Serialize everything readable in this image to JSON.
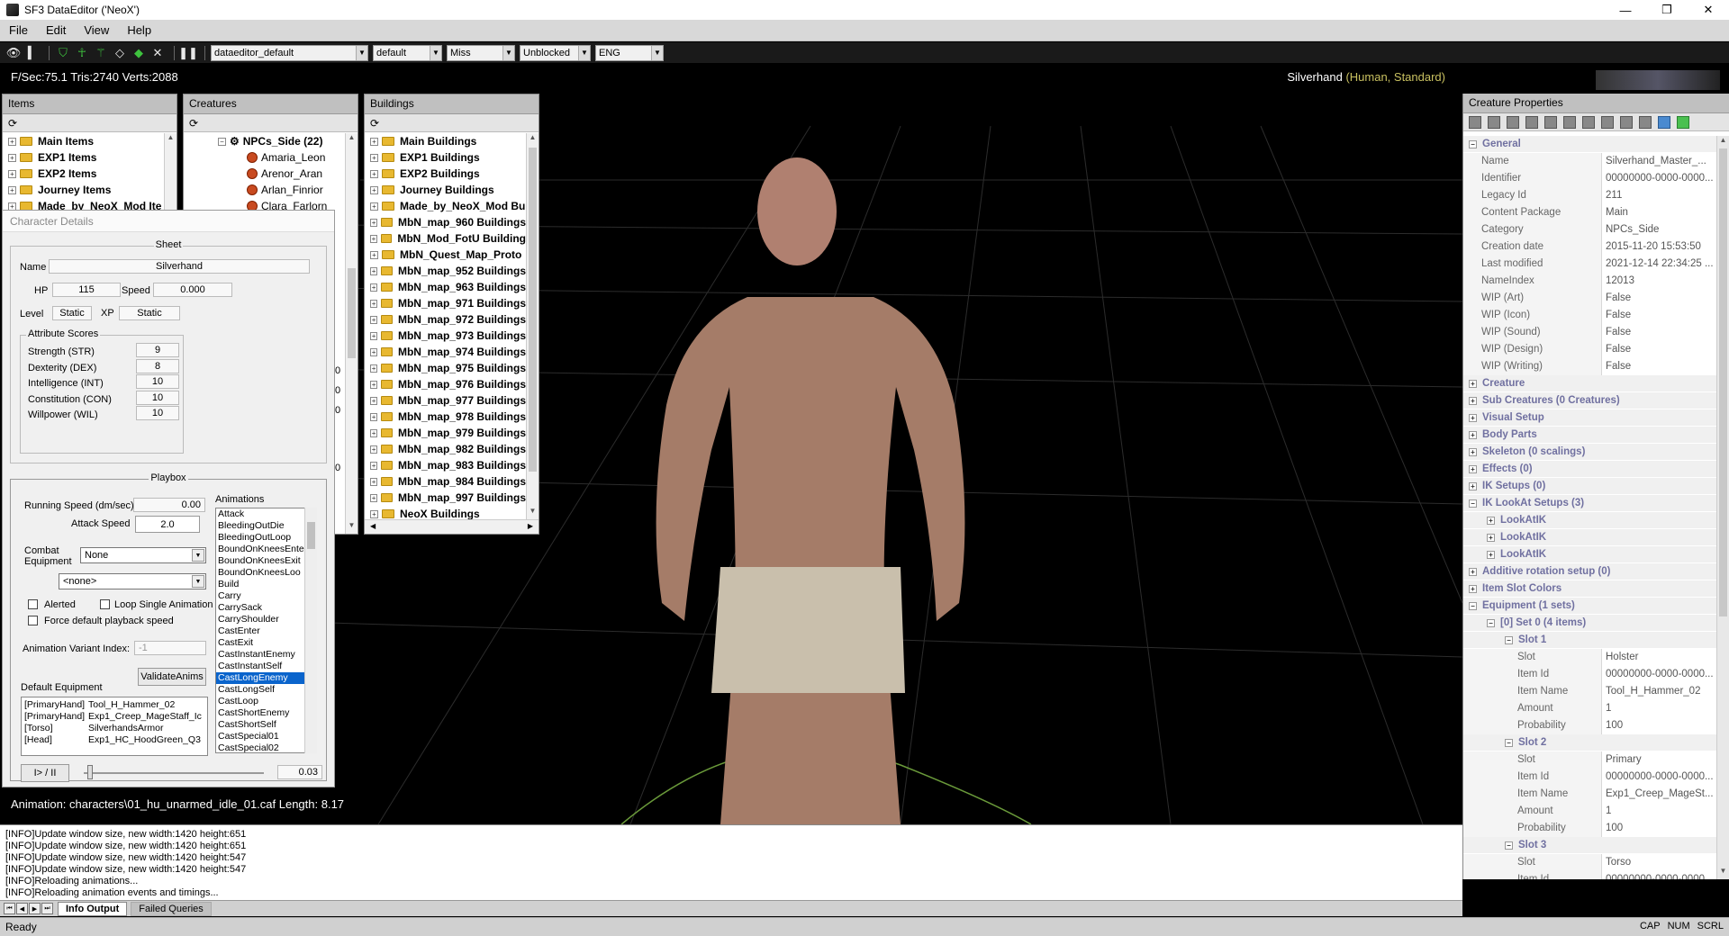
{
  "window": {
    "title": "SF3 DataEditor ('NeoX')",
    "minimize": "—",
    "maximize": "❐",
    "close": "✕"
  },
  "menu": [
    "File",
    "Edit",
    "View",
    "Help"
  ],
  "toolbar": {
    "combos": [
      "dataeditor_default",
      "default",
      "Miss",
      "Unblocked",
      "ENG"
    ]
  },
  "viewport": {
    "stats": "F/Sec:75.1 Tris:2740 Verts:2088",
    "char_name": "Silverhand",
    "char_sub": "(Human, Standard)",
    "anim_status": "Animation: characters\\01_hu_unarmed_idle_01.caf   Length: 8.17"
  },
  "items_panel": {
    "title": "Items",
    "rows": [
      "Main Items",
      "EXP1 Items",
      "EXP2 Items",
      "Journey Items",
      "Made_by_NeoX_Mod Ite"
    ]
  },
  "creatures_panel": {
    "title": "Creatures",
    "group": "NPCs_Side (22)",
    "rows": [
      "Amaria_Leon",
      "Arenor_Aran",
      "Arlan_Finrior",
      "Clara_Farlorn"
    ],
    "side_nums": [
      "0",
      "0",
      "0",
      "0"
    ]
  },
  "buildings_panel": {
    "title": "Buildings",
    "rows": [
      "Main Buildings",
      "EXP1 Buildings",
      "EXP2 Buildings",
      "Journey Buildings",
      "Made_by_NeoX_Mod Bu",
      "MbN_map_960 Buildings",
      "MbN_Mod_FotU Building",
      "MbN_Quest_Map_Proto",
      "MbN_map_952 Buildings",
      "MbN_map_963 Buildings",
      "MbN_map_971 Buildings",
      "MbN_map_972 Buildings",
      "MbN_map_973 Buildings",
      "MbN_map_974 Buildings",
      "MbN_map_975 Buildings",
      "MbN_map_976 Buildings",
      "MbN_map_977 Buildings",
      "MbN_map_978 Buildings",
      "MbN_map_979 Buildings",
      "MbN_map_982 Buildings",
      "MbN_map_983 Buildings",
      "MbN_map_984 Buildings",
      "MbN_map_997 Buildings",
      "NeoX Buildings"
    ]
  },
  "char_details": {
    "title": "Character Details",
    "sheet": "Sheet",
    "name_label": "Name",
    "name": "Silverhand",
    "hp_label": "HP",
    "hp": "115",
    "speed_label": "Speed",
    "speed": "0.000",
    "level_label": "Level",
    "level": "Static",
    "xp_label": "XP",
    "xp": "Static",
    "attr_title": "Attribute Scores",
    "attrs": [
      {
        "k": "Strength (STR)",
        "v": "9"
      },
      {
        "k": "Dexterity (DEX)",
        "v": "8"
      },
      {
        "k": "Intelligence (INT)",
        "v": "10"
      },
      {
        "k": "Constitution (CON)",
        "v": "10"
      },
      {
        "k": "Willpower (WIL)",
        "v": "10"
      }
    ],
    "playbox": "Playbox",
    "running_label": "Running Speed (dm/sec)",
    "running": "0.00",
    "attack_label": "Attack Speed",
    "attack": "2.0",
    "combat_label1": "Combat",
    "combat_label2": "Equipment",
    "combat": "None",
    "none2": "<none>",
    "alerted": "Alerted",
    "loop": "Loop Single Animation",
    "force": "Force default playback speed",
    "variant_label": "Animation Variant Index:",
    "variant": "-1",
    "validate": "ValidateAnims",
    "defequip_label": "Default Equipment",
    "equip": [
      {
        "s": "[PrimaryHand]",
        "v": "Tool_H_Hammer_02"
      },
      {
        "s": "[PrimaryHand]",
        "v": "Exp1_Creep_MageStaff_Ic"
      },
      {
        "s": "[Torso]",
        "v": "SilverhandsArmor"
      },
      {
        "s": "[Head]",
        "v": "Exp1_HC_HoodGreen_Q3"
      }
    ],
    "anims_label": "Animations",
    "anims": [
      "Attack",
      "BleedingOutDie",
      "BleedingOutLoop",
      "BoundOnKneesEnte",
      "BoundOnKneesExit",
      "BoundOnKneesLoo",
      "Build",
      "Carry",
      "CarrySack",
      "CarryShoulder",
      "CastEnter",
      "CastExit",
      "CastInstantEnemy",
      "CastInstantSelf",
      "CastLongEnemy",
      "CastLongSelf",
      "CastLoop",
      "CastShortEnemy",
      "CastShortSelf",
      "CastSpecial01",
      "CastSpecial02"
    ],
    "selected_anim": "CastLongEnemy",
    "play": "I> / II",
    "time": "0.03"
  },
  "props": {
    "title": "Creature Properties",
    "general": "General",
    "general_rows": [
      {
        "k": "Name",
        "v": "Silverhand_Master_..."
      },
      {
        "k": "Identifier",
        "v": "00000000-0000-0000..."
      },
      {
        "k": "Legacy Id",
        "v": "211"
      },
      {
        "k": "Content Package",
        "v": "Main"
      },
      {
        "k": "Category",
        "v": "NPCs_Side"
      },
      {
        "k": "Creation date",
        "v": "2015-11-20 15:53:50"
      },
      {
        "k": "Last modified",
        "v": "2021-12-14 22:34:25 ..."
      },
      {
        "k": "NameIndex",
        "v": "12013"
      },
      {
        "k": "WIP (Art)",
        "v": "False"
      },
      {
        "k": "WIP (Icon)",
        "v": "False"
      },
      {
        "k": "WIP (Sound)",
        "v": "False"
      },
      {
        "k": "WIP (Design)",
        "v": "False"
      },
      {
        "k": "WIP (Writing)",
        "v": "False"
      }
    ],
    "cats": [
      "Creature",
      "Sub Creatures (0 Creatures)",
      "Visual Setup",
      "Body Parts",
      "Skeleton (0 scalings)",
      "Effects (0)",
      "IK Setups (0)",
      "IK LookAt Setups (3)"
    ],
    "lookats": [
      "LookAtIK",
      "LookAtIK",
      "LookAtIK"
    ],
    "cats2": [
      "Additive rotation setup (0)",
      "Item Slot Colors",
      "Equipment (1 sets)"
    ],
    "set0": "[0] Set 0 (4 items)",
    "slots": [
      {
        "title": "Slot 1",
        "rows": [
          {
            "k": "Slot",
            "v": "Holster"
          },
          {
            "k": "Item Id",
            "v": "00000000-0000-0000..."
          },
          {
            "k": "Item Name",
            "v": "Tool_H_Hammer_02"
          },
          {
            "k": "Amount",
            "v": "1"
          },
          {
            "k": "Probability",
            "v": "100"
          }
        ]
      },
      {
        "title": "Slot 2",
        "rows": [
          {
            "k": "Slot",
            "v": "Primary"
          },
          {
            "k": "Item Id",
            "v": "00000000-0000-0000..."
          },
          {
            "k": "Item Name",
            "v": "Exp1_Creep_MageSt..."
          },
          {
            "k": "Amount",
            "v": "1"
          },
          {
            "k": "Probability",
            "v": "100"
          }
        ]
      },
      {
        "title": "Slot 3",
        "rows": [
          {
            "k": "Slot",
            "v": "Torso"
          },
          {
            "k": "Item Id",
            "v": "00000000-0000-0000..."
          }
        ]
      }
    ]
  },
  "log": {
    "lines": [
      "[INFO]Update window size, new width:1420 height:651",
      "[INFO]Update window size, new width:1420 height:651",
      "[INFO]Update window size, new width:1420 height:547",
      "[INFO]Update window size, new width:1420 height:547",
      "[INFO]Reloading animations...",
      "[INFO]Reloading animation events and timings..."
    ],
    "tab_on": "Info Output",
    "tab_off": "Failed Queries"
  },
  "status": {
    "text": "Ready",
    "cap": "CAP",
    "num": "NUM",
    "scrl": "SCRL"
  }
}
